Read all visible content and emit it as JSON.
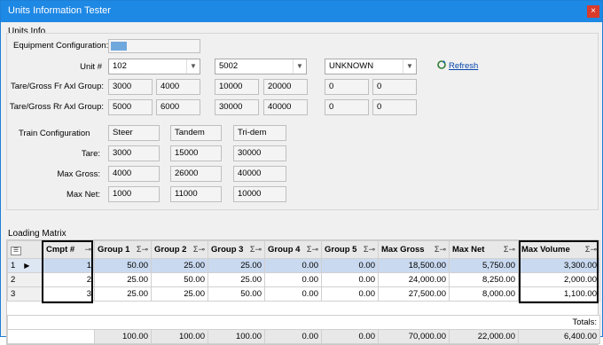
{
  "window": {
    "title": "Units Information Tester",
    "close": "×"
  },
  "units_info": {
    "group_label": "Units Info",
    "equipment_label": "Equipment Configuration:",
    "equipment_color": "#6fa8dc",
    "unit_label": "Unit #",
    "unit_combos": [
      "102",
      "5002",
      "UNKNOWN"
    ],
    "refresh_label": "Refresh",
    "fr_label": "Tare/Gross Fr Axl Group:",
    "fr_values": [
      "3000",
      "4000",
      "10000",
      "20000",
      "0",
      "0"
    ],
    "rr_label": "Tare/Gross Rr Axl Group:",
    "rr_values": [
      "5000",
      "6000",
      "30000",
      "40000",
      "0",
      "0"
    ],
    "train_label": "Train Configuration",
    "train_values": [
      "Steer",
      "Tandem",
      "Tri-dem"
    ],
    "tare_label": "Tare:",
    "tare_values": [
      "3000",
      "15000",
      "30000"
    ],
    "maxgross_label": "Max Gross:",
    "maxgross_values": [
      "4000",
      "26000",
      "40000"
    ],
    "maxnet_label": "Max Net:",
    "maxnet_values": [
      "1000",
      "11000",
      "10000"
    ]
  },
  "loading_matrix": {
    "group_label": "Loading Matrix",
    "columns": [
      "Cmpt #",
      "Group 1",
      "Group 2",
      "Group 3",
      "Group 4",
      "Group 5",
      "Max Gross",
      "Max Net",
      "Max Volume"
    ],
    "rows": [
      {
        "num": "1",
        "selected": true,
        "cells": [
          "1",
          "50.00",
          "25.00",
          "25.00",
          "0.00",
          "0.00",
          "18,500.00",
          "5,750.00",
          "3,300.00"
        ]
      },
      {
        "num": "2",
        "selected": false,
        "cells": [
          "2",
          "25.00",
          "50.00",
          "25.00",
          "0.00",
          "0.00",
          "24,000.00",
          "8,250.00",
          "2,000.00"
        ]
      },
      {
        "num": "3",
        "selected": false,
        "cells": [
          "3",
          "25.00",
          "25.00",
          "50.00",
          "0.00",
          "0.00",
          "27,500.00",
          "8,000.00",
          "1,100.00"
        ]
      }
    ],
    "totals_label": "Totals:",
    "totals": [
      "",
      "100.00",
      "100.00",
      "100.00",
      "0.00",
      "0.00",
      "70,000.00",
      "22,000.00",
      "6,400.00"
    ]
  }
}
